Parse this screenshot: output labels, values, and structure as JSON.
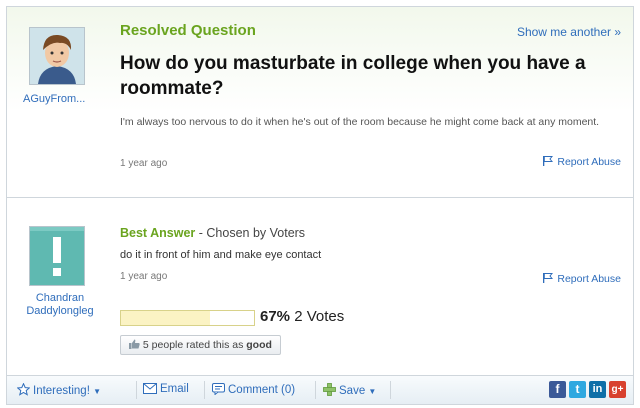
{
  "question": {
    "status_label": "Resolved Question",
    "show_another": "Show me another »",
    "asker_name": "AGuyFrom...",
    "title": "How do you masturbate in college when you have a roommate?",
    "body": "I'm always too nervous to do it when he's out of the room because he might come back at any moment.",
    "time": "1 year ago",
    "report": "Report Abuse"
  },
  "answer": {
    "best_label": "Best Answer",
    "chosen_by": "- Chosen by Voters",
    "answerer_line1": "Chandran",
    "answerer_line2": "Daddylongleg",
    "body": "do it in front of him and make eye contact",
    "time": "1 year ago",
    "report": "Report Abuse",
    "vote_fraction": 0.67,
    "vote_pct": "67%",
    "vote_count": "2 Votes",
    "rated_text": "5 people rated this as",
    "rated_word": "good"
  },
  "toolbar": {
    "interesting": "Interesting!",
    "email": "Email",
    "comment": "Comment (0)",
    "save": "Save"
  },
  "colors": {
    "accent_green": "#6aa41f",
    "link_blue": "#2f6dbb"
  },
  "icons": [
    "star-icon",
    "mail-icon",
    "comment-icon",
    "plus-icon",
    "flag-icon",
    "thumbs-up-icon",
    "facebook-icon",
    "twitter-icon",
    "linkedin-icon",
    "googleplus-icon"
  ]
}
